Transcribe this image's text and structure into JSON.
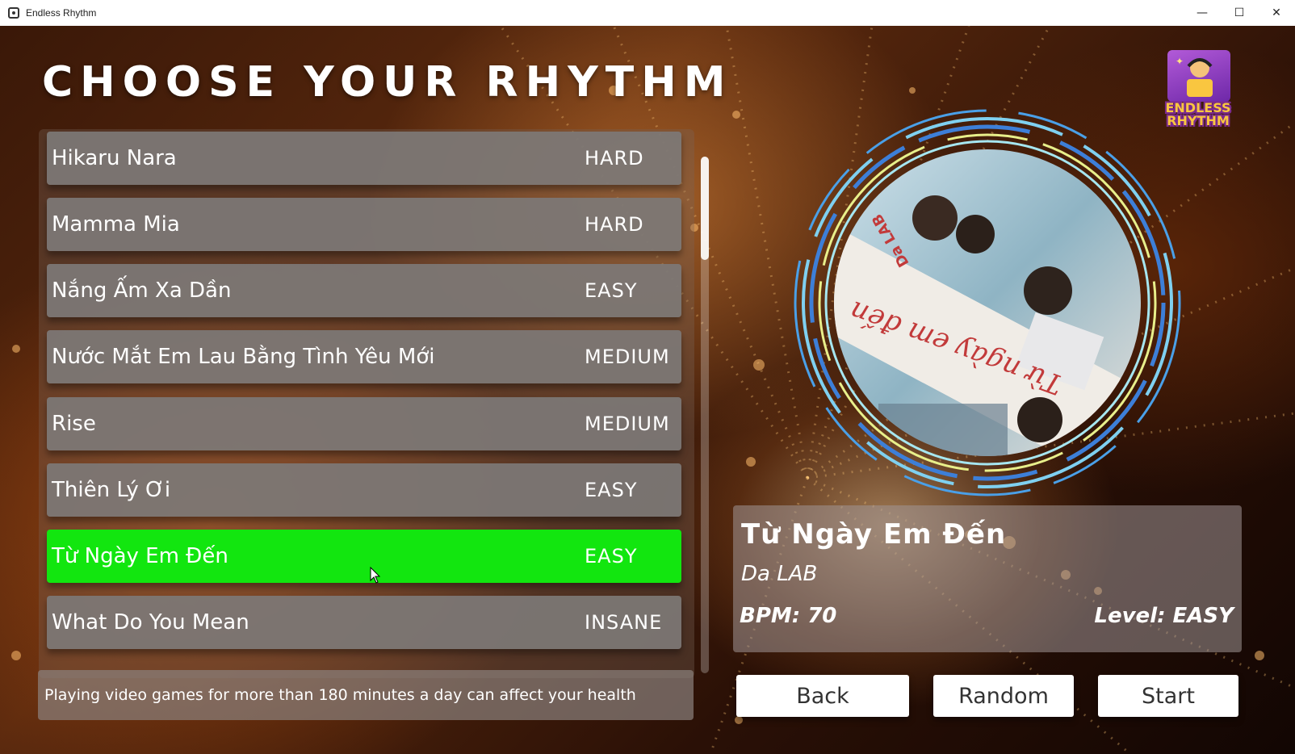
{
  "window": {
    "title": "Endless Rhythm",
    "controls": {
      "minimize": "—",
      "maximize": "☐",
      "close": "✕"
    }
  },
  "heading": "CHOOSE YOUR RHYTHM",
  "songs": [
    {
      "name": "Hikaru Nara",
      "difficulty": "HARD"
    },
    {
      "name": "Mamma Mia",
      "difficulty": "HARD"
    },
    {
      "name": "Nắng Ấm Xa Dần",
      "difficulty": "EASY"
    },
    {
      "name": "Nước Mắt Em Lau Bằng Tình Yêu Mới",
      "difficulty": "MEDIUM"
    },
    {
      "name": "Rise",
      "difficulty": "MEDIUM"
    },
    {
      "name": "Thiên Lý Ơi",
      "difficulty": "EASY"
    },
    {
      "name": "Từ Ngày Em Đến",
      "difficulty": "EASY"
    },
    {
      "name": "What Do You Mean",
      "difficulty": "INSANE"
    }
  ],
  "selected_index": 6,
  "health_notice": "Playing video games for more than 180 minutes a day can affect your health",
  "logo": {
    "line1": "ENDLESS",
    "line2": "RHYTHM"
  },
  "disc": {
    "cover_text": "Từ ngày em đến",
    "cover_brand": "Da LAB"
  },
  "selected_song": {
    "title": "Từ Ngày Em Đến",
    "artist": "Da LAB",
    "bpm_text": "BPM: 70",
    "level_text": "Level: EASY"
  },
  "buttons": {
    "back": "Back",
    "random": "Random",
    "start": "Start"
  },
  "colors": {
    "selected_row": "#12e60f",
    "logo_gold": "#f9c640",
    "logo_purple": "#7b2b8f"
  }
}
